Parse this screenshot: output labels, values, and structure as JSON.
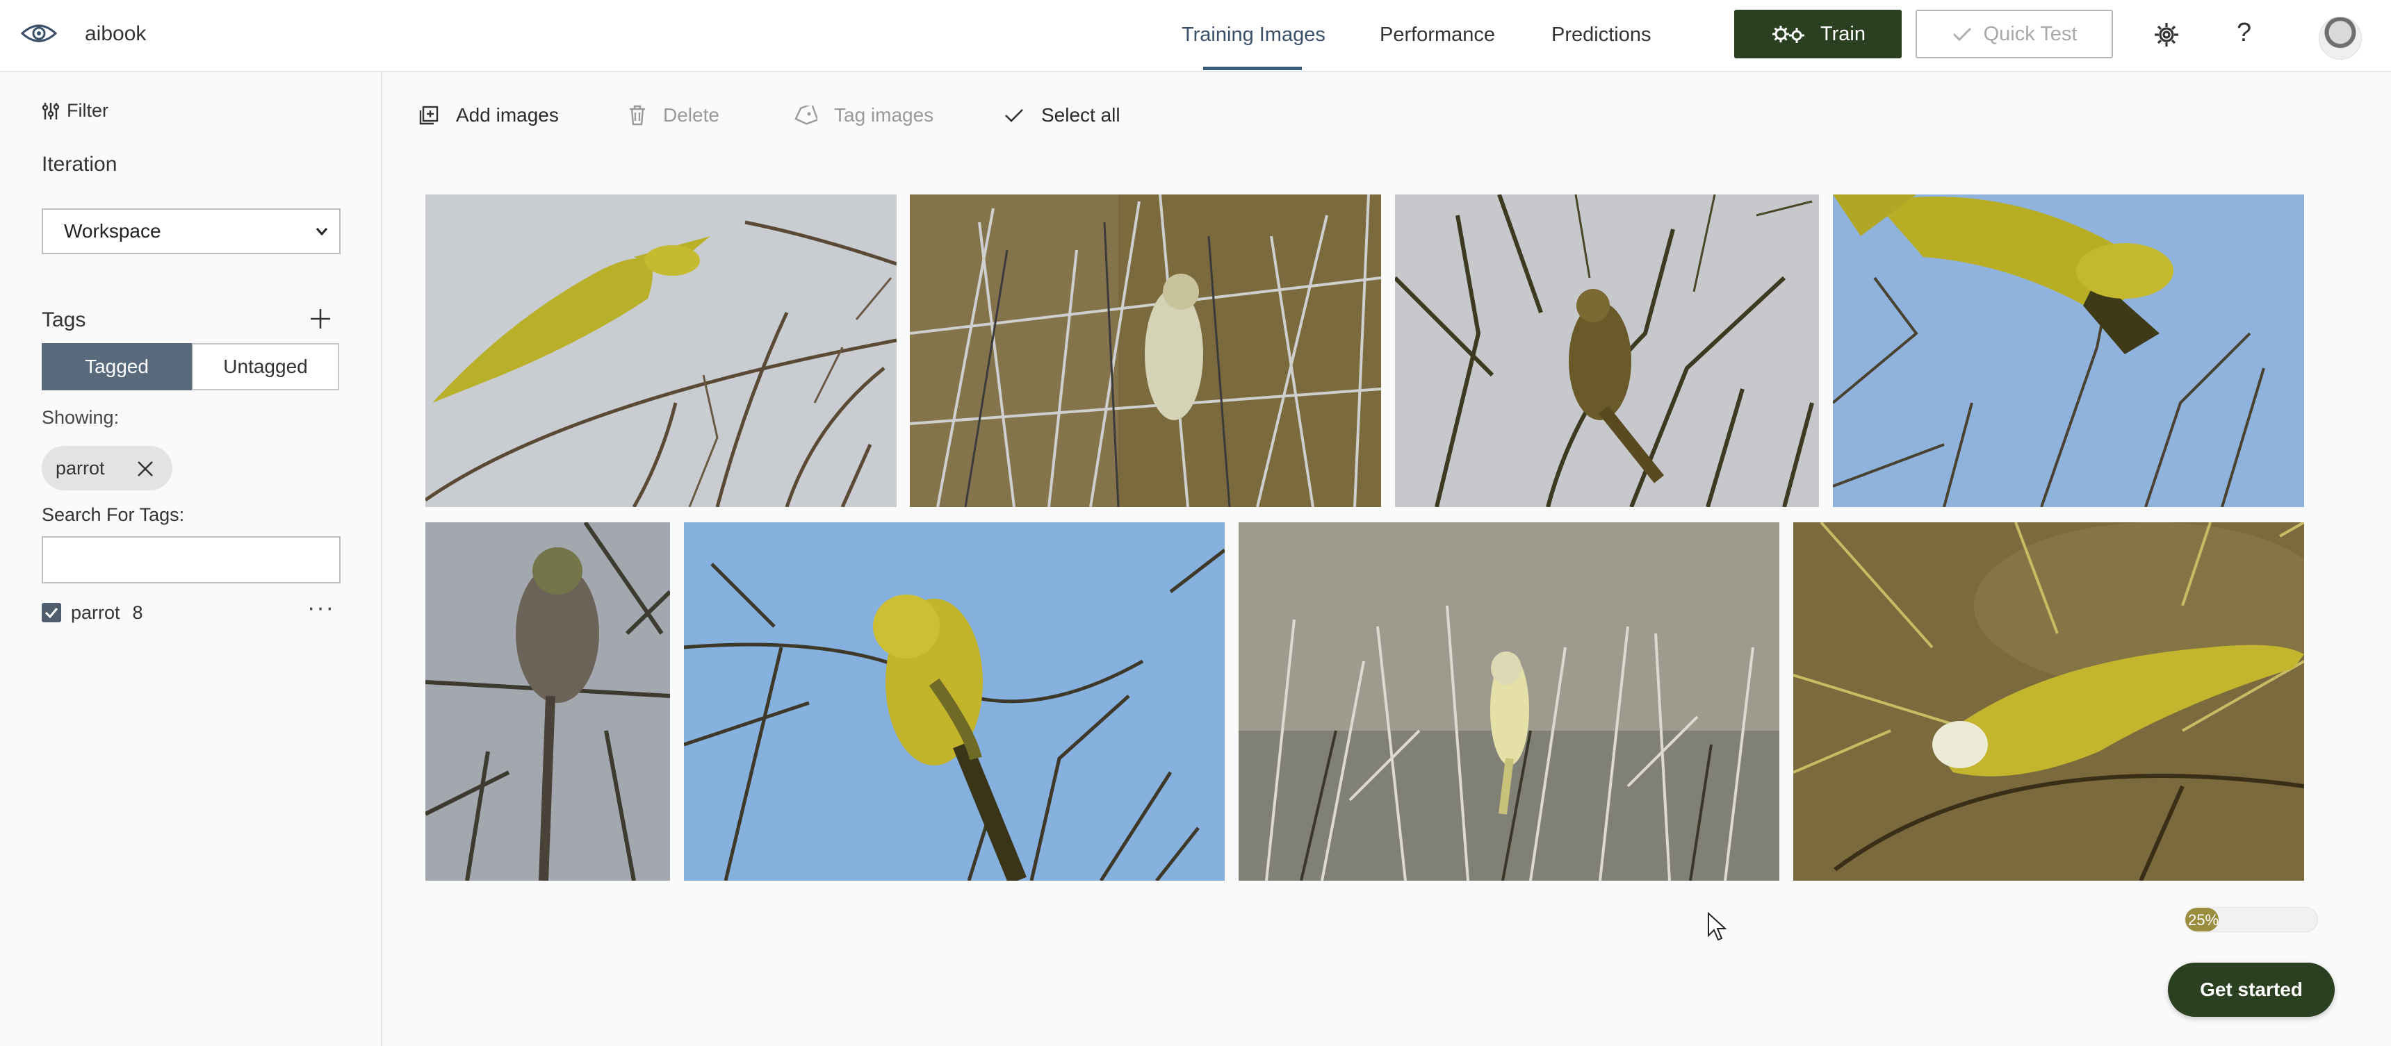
{
  "header": {
    "app_name": "aibook",
    "tabs": [
      {
        "label": "Training Images",
        "active": true
      },
      {
        "label": "Performance",
        "active": false
      },
      {
        "label": "Predictions",
        "active": false
      }
    ],
    "train_label": "Train",
    "quick_test_label": "Quick Test",
    "help_glyph": "?",
    "icons": [
      "eye-logo-icon",
      "gears-icon",
      "checkmark-icon",
      "settings-gear-icon",
      "help-icon",
      "avatar"
    ]
  },
  "sidebar": {
    "filter_label": "Filter",
    "iteration_title": "Iteration",
    "iteration_selected": "Workspace",
    "tags_title": "Tags",
    "tagged_label": "Tagged",
    "untagged_label": "Untagged",
    "showing_label": "Showing:",
    "active_filter_chip": "parrot",
    "search_label": "Search For Tags:",
    "search_value": "",
    "tag_list": [
      {
        "name": "parrot",
        "count": "8",
        "checked": true
      }
    ],
    "more_glyph": "···"
  },
  "toolbar": {
    "add_images": "Add images",
    "delete": "Delete",
    "tag_images": "Tag images",
    "select_all": "Select all"
  },
  "gallery": {
    "images": [
      {
        "subject": "yellow parrot flying",
        "sky": "#c9cdd2"
      },
      {
        "subject": "pale parrot among twigs",
        "sky": "#7a6a3e"
      },
      {
        "subject": "olive parrot on branch",
        "sky": "#c6c8cb"
      },
      {
        "subject": "yellow parrot flying",
        "sky": "#8fb3dc"
      },
      {
        "subject": "grey parrot perched",
        "sky": "#a3a7ae"
      },
      {
        "subject": "yellow parrot on branch",
        "sky": "#86b0de"
      },
      {
        "subject": "pale yellow parrot in bush",
        "sky": "#9e9a8e"
      },
      {
        "subject": "yellow parrot on branch",
        "sky": "#7a6a3e"
      }
    ]
  },
  "footer": {
    "progress_percent": 25,
    "progress_label": "25%",
    "get_started_label": "Get started"
  },
  "colors": {
    "primary_dark_green": "#2a4021",
    "segment_active": "#5a6a7d",
    "nav_active_underline": "#3a5a7a",
    "progress_fill": "#9b8d3e"
  }
}
